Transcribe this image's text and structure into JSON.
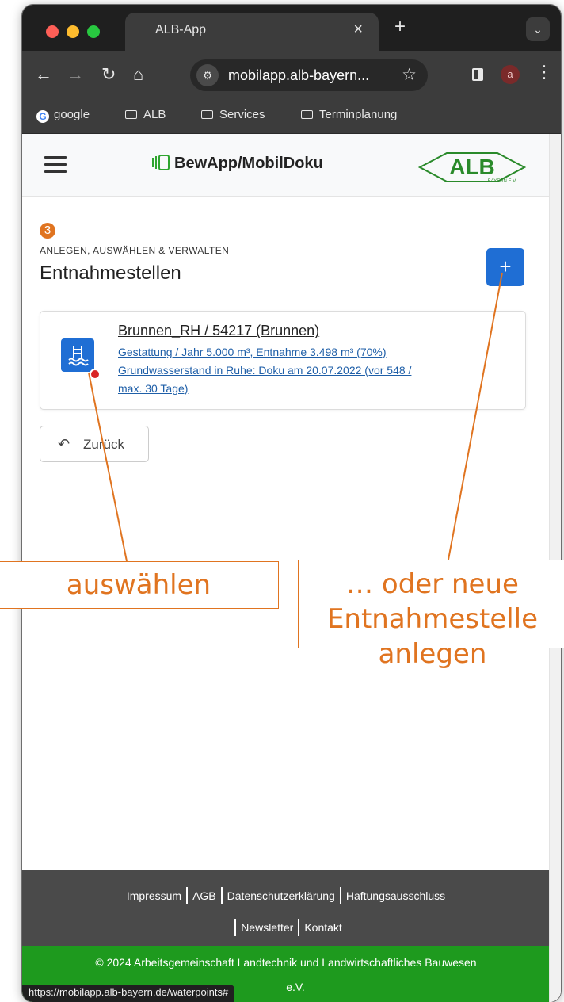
{
  "browser": {
    "tab_title": "ALB-App",
    "tab_close": "×",
    "new_tab": "+",
    "tab_menu": "⌄",
    "url": "mobilapp.alb-bayern...",
    "profile_initial": "a",
    "bookmarks": [
      "google",
      "ALB",
      "Services",
      "Terminplanung"
    ],
    "status_url": "https://mobilapp.alb-bayern.de/waterpoints#"
  },
  "navbar": {
    "brand": "BewApp/MobilDoku",
    "logo_text": "ALB",
    "logo_sub": "BAYERN E.V."
  },
  "main": {
    "step_number": "3",
    "kicker": "ANLEGEN, AUSWÄHLEN & VERWALTEN",
    "heading": "Entnahmestellen",
    "add_label": "+",
    "card": {
      "title": "Brunnen_RH / 54217 (Brunnen)",
      "line1": "Gestattung / Jahr 5.000 m³, Entnahme 3.498 m³ (70%)",
      "line2": "Grundwasserstand in Ruhe: Doku am 20.07.2022 (vor 548 /",
      "line3": "max. 30 Tage)"
    },
    "back_label": "Zurück"
  },
  "footer": {
    "links_row1": [
      "Impressum",
      "AGB",
      "Datenschutzerklärung",
      "Haftungsausschluss"
    ],
    "links_row2": [
      "Newsletter",
      "Kontakt"
    ],
    "copyright_line1": "© 2024 Arbeitsgemeinschaft Landtechnik und Landwirtschaftliches Bauwesen",
    "copyright_line2_tail": "e.V."
  },
  "annotations": {
    "select": "auswählen",
    "create_line1": "… oder neue",
    "create_line2": "Entnahmestelle",
    "create_line3": "anlegen"
  },
  "colors": {
    "accent_blue": "#1f6ed4",
    "annotation_orange": "#e07420",
    "footer_green": "#1e9a1e",
    "footer_dark": "#4a4a4a",
    "status_red": "#d92525"
  },
  "icons": {
    "card_icon": "swimming-pool-icon",
    "back_icon": "undo-arrow-icon",
    "brand_icon": "phone-icon"
  }
}
